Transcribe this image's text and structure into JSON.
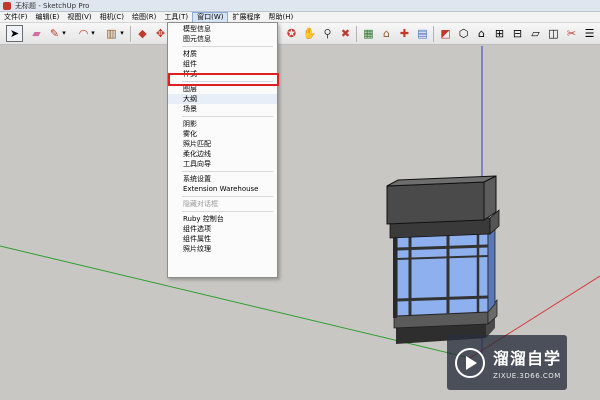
{
  "window": {
    "title": "无标题 - SketchUp Pro"
  },
  "menubar": {
    "items": [
      {
        "label": "文件(F)"
      },
      {
        "label": "编辑(E)"
      },
      {
        "label": "视图(V)"
      },
      {
        "label": "相机(C)"
      },
      {
        "label": "绘图(R)"
      },
      {
        "label": "工具(T)"
      },
      {
        "label": "窗口(W)",
        "active": true
      },
      {
        "label": "扩展程序"
      },
      {
        "label": "帮助(H)"
      }
    ]
  },
  "toolbar": {
    "icons": [
      "select-arrow",
      "eraser",
      "pencil-line",
      "arc",
      "rectangle",
      "push-pull",
      "move",
      "rotate",
      "tape-measure",
      "paint-bucket",
      "orbit",
      "pan",
      "zoom",
      "zoom-extents",
      "components",
      "warehouse",
      "extension-warehouse",
      "styles",
      "section-plane",
      "iso-view",
      "top-view",
      "front-view",
      "right-view",
      "back-view",
      "left-view",
      "bottom-view",
      "xray",
      "wireframe"
    ]
  },
  "window_menu": {
    "items": [
      {
        "label": "模型信息"
      },
      {
        "label": "图元信息"
      },
      {
        "separator": true
      },
      {
        "label": "材质"
      },
      {
        "label": "组件"
      },
      {
        "label": "样式",
        "highlighted": true
      },
      {
        "separator": true
      },
      {
        "label": "图层"
      },
      {
        "label": "大纲",
        "hover": true
      },
      {
        "label": "场景"
      },
      {
        "separator": true
      },
      {
        "label": "阴影"
      },
      {
        "label": "雾化"
      },
      {
        "label": "照片匹配"
      },
      {
        "label": "柔化边线"
      },
      {
        "label": "工具向导"
      },
      {
        "separator": true
      },
      {
        "label": "系统设置"
      },
      {
        "label": "Extension Warehouse"
      },
      {
        "separator": true
      },
      {
        "label": "隐藏对话框",
        "disabled": true
      },
      {
        "separator": true
      },
      {
        "label": "Ruby 控制台"
      },
      {
        "label": "组件选项"
      },
      {
        "label": "组件属性"
      },
      {
        "label": "照片纹理"
      }
    ]
  },
  "watermark": {
    "title": "溜溜自学",
    "url": "ZIXUE.3D66.COM"
  },
  "colors": {
    "axis_red": "#d23b3b",
    "axis_green": "#2f9e2f",
    "axis_blue": "#3a3ad6",
    "glass": "#8fb0ee",
    "frame": "#3a3a3a",
    "highlight": "#e02020"
  }
}
